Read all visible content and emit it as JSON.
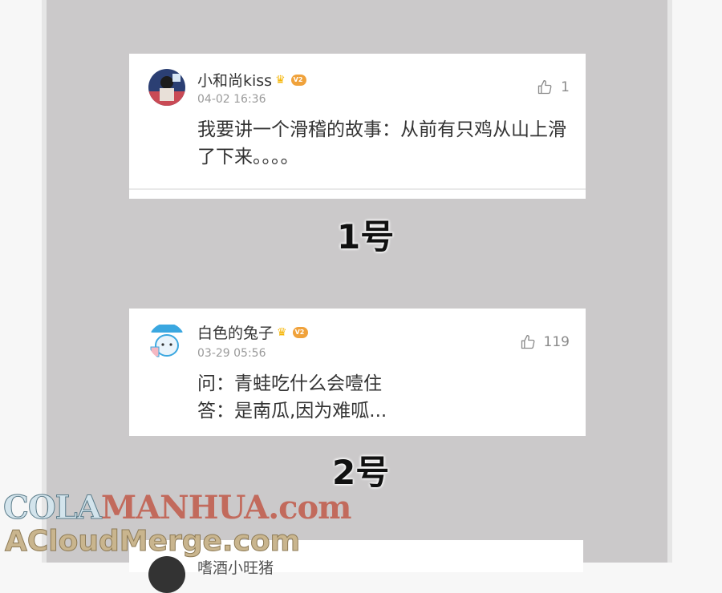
{
  "comments": [
    {
      "username": "小和尚kiss",
      "vip_level": "V2",
      "timestamp": "04-02 16:36",
      "likes": "1",
      "content": "我要讲一个滑稽的故事：从前有只鸡从山上滑了下来。。。。",
      "label": "1号"
    },
    {
      "username": "白色的兔子",
      "vip_level": "V2",
      "timestamp": "03-29 05:56",
      "likes": "119",
      "content_lines": [
        "问：青蛙吃什么会噎住",
        "答：是南瓜,因为难呱..."
      ],
      "label": "2号"
    },
    {
      "username": "嗜酒小旺猪"
    }
  ],
  "watermark": {
    "line1_part1": "COLA",
    "line1_part2": "MANHUA.com",
    "line2": "ACloudMerge.com"
  }
}
